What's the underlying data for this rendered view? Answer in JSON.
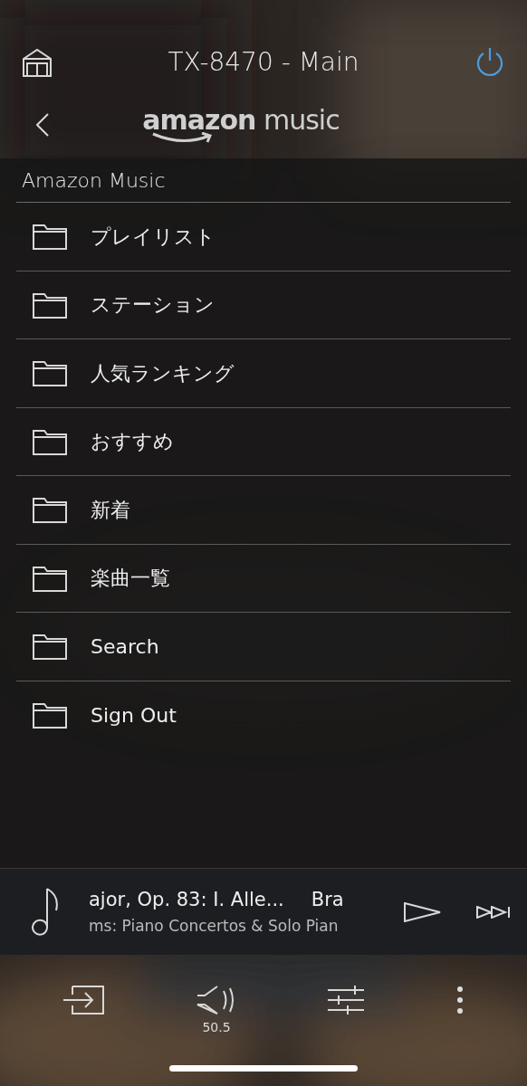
{
  "header": {
    "title": "TX-8470 - Main",
    "power_on": true
  },
  "service": {
    "logo": "**amazon** music"
  },
  "list": {
    "title": "Amazon Music",
    "items": [
      {
        "label": "プレイリスト"
      },
      {
        "label": "ステーション"
      },
      {
        "label": "人気ランキング"
      },
      {
        "label": "おすすめ"
      },
      {
        "label": "新着"
      },
      {
        "label": "楽曲一覧"
      },
      {
        "label": "Search"
      },
      {
        "label": "Sign Out"
      }
    ]
  },
  "now_playing": {
    "track": "ajor, Op. 83: I. Alle...",
    "artist": "Bra",
    "album": "ms: Piano Concertos & Solo Pian"
  },
  "bottom_bar": {
    "volume": "50.5"
  }
}
